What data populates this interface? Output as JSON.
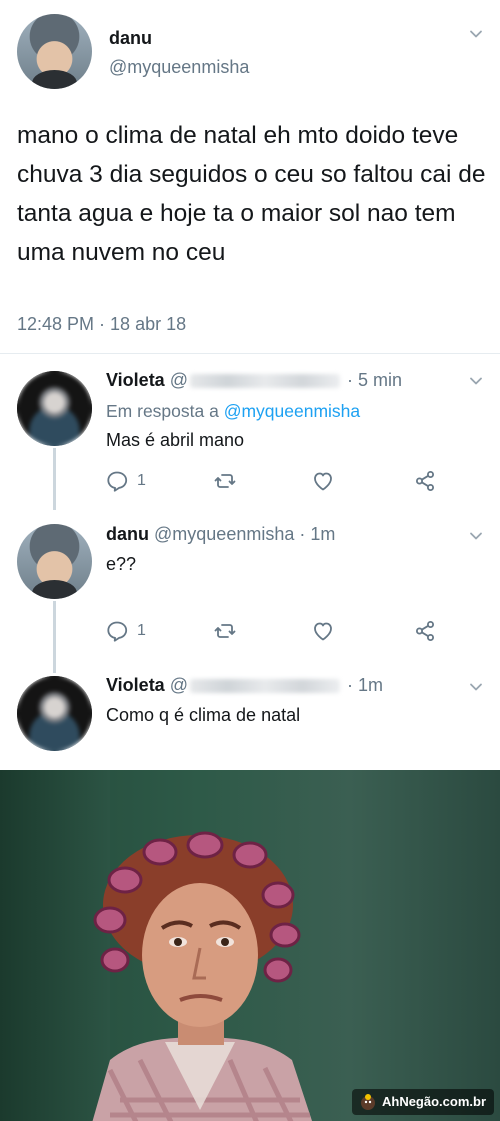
{
  "main_tweet": {
    "author_name": "danu",
    "author_handle": "@myqueenmisha",
    "text": "mano o clima de natal eh mto doido teve chuva 3 dia seguidos o ceu so faltou cai de tanta agua e hoje ta o maior sol nao tem uma nuvem no ceu",
    "timestamp": "12:48 PM · 18 abr 18"
  },
  "replies": [
    {
      "author_name": "Violeta",
      "handle_prefix": "@",
      "time": "· 5 min",
      "reply_to_label": "Em resposta a",
      "reply_to_handle": "@myqueenmisha",
      "text": "Mas é abril mano",
      "reply_count": "1"
    },
    {
      "author_name": "danu",
      "author_handle": "@myqueenmisha",
      "time": "· 1m",
      "text": "e??",
      "reply_count": "1"
    },
    {
      "author_name": "Violeta",
      "handle_prefix": "@",
      "time": "· 1m",
      "text": "Como q é clima de natal"
    }
  ],
  "watermark": {
    "text": "AhNegão.com.br"
  },
  "icons": {
    "chevron": "chevron-down-icon",
    "reply": "reply-icon",
    "retweet": "retweet-icon",
    "like": "heart-icon",
    "share": "share-icon"
  },
  "colors": {
    "primary_text": "#14171a",
    "secondary_text": "#657786",
    "link": "#1da1f2",
    "divider": "#e6ecf0",
    "thread_line": "#ccd6dd"
  }
}
